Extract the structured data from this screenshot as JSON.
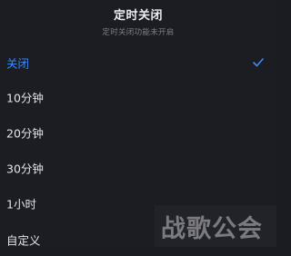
{
  "header": {
    "title": "定时关闭",
    "subtitle": "定时关闭功能未开启"
  },
  "options": [
    {
      "label": "关闭",
      "selected": true
    },
    {
      "label": "10分钟",
      "selected": false
    },
    {
      "label": "20分钟",
      "selected": false
    },
    {
      "label": "30分钟",
      "selected": false
    },
    {
      "label": "1小时",
      "selected": false
    },
    {
      "label": "自定义",
      "selected": false
    }
  ],
  "accent_color": "#3d8af7",
  "check_icon": "check-icon",
  "watermark": {
    "text": "战歌公会"
  }
}
